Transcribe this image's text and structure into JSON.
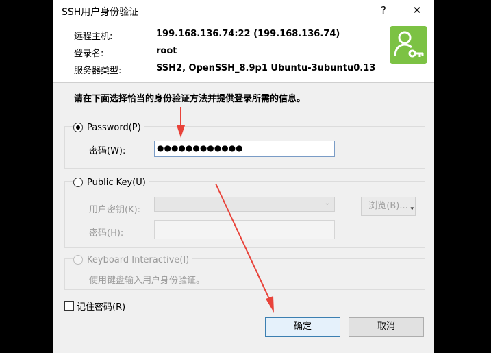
{
  "window": {
    "title": "SSH用户身份验证",
    "help_glyph": "?",
    "close_glyph": "✕"
  },
  "info": {
    "host_label": "远程主机:",
    "host_value": "199.168.136.74:22 (199.168.136.74)",
    "login_label": "登录名:",
    "login_value": "root",
    "server_label": "服务器类型:",
    "server_value": "SSH2, OpenSSH_8.9p1 Ubuntu-3ubuntu0.13"
  },
  "instruction": "请在下面选择恰当的身份验证方法并提供登录所需的信息。",
  "password_group": {
    "radio_label": "Password(P)",
    "field_label": "密码(W):",
    "value": "●●●●●●●●●●●●"
  },
  "publickey_group": {
    "radio_label": "Public Key(U)",
    "key_label": "用户密钥(K):",
    "passphrase_label": "密码(H):",
    "browse_label": "浏览(B)...",
    "browse_arrow": "▾",
    "select_chevron": "⌄"
  },
  "keyboard_group": {
    "radio_label": "Keyboard Interactive(I)",
    "hint": "使用键盘输入用户身份验证。"
  },
  "remember_label": "记住密码(R)",
  "buttons": {
    "ok": "确定",
    "cancel": "取消"
  },
  "colors": {
    "accent_green": "#7cc244",
    "arrow_red": "#e8433a"
  }
}
